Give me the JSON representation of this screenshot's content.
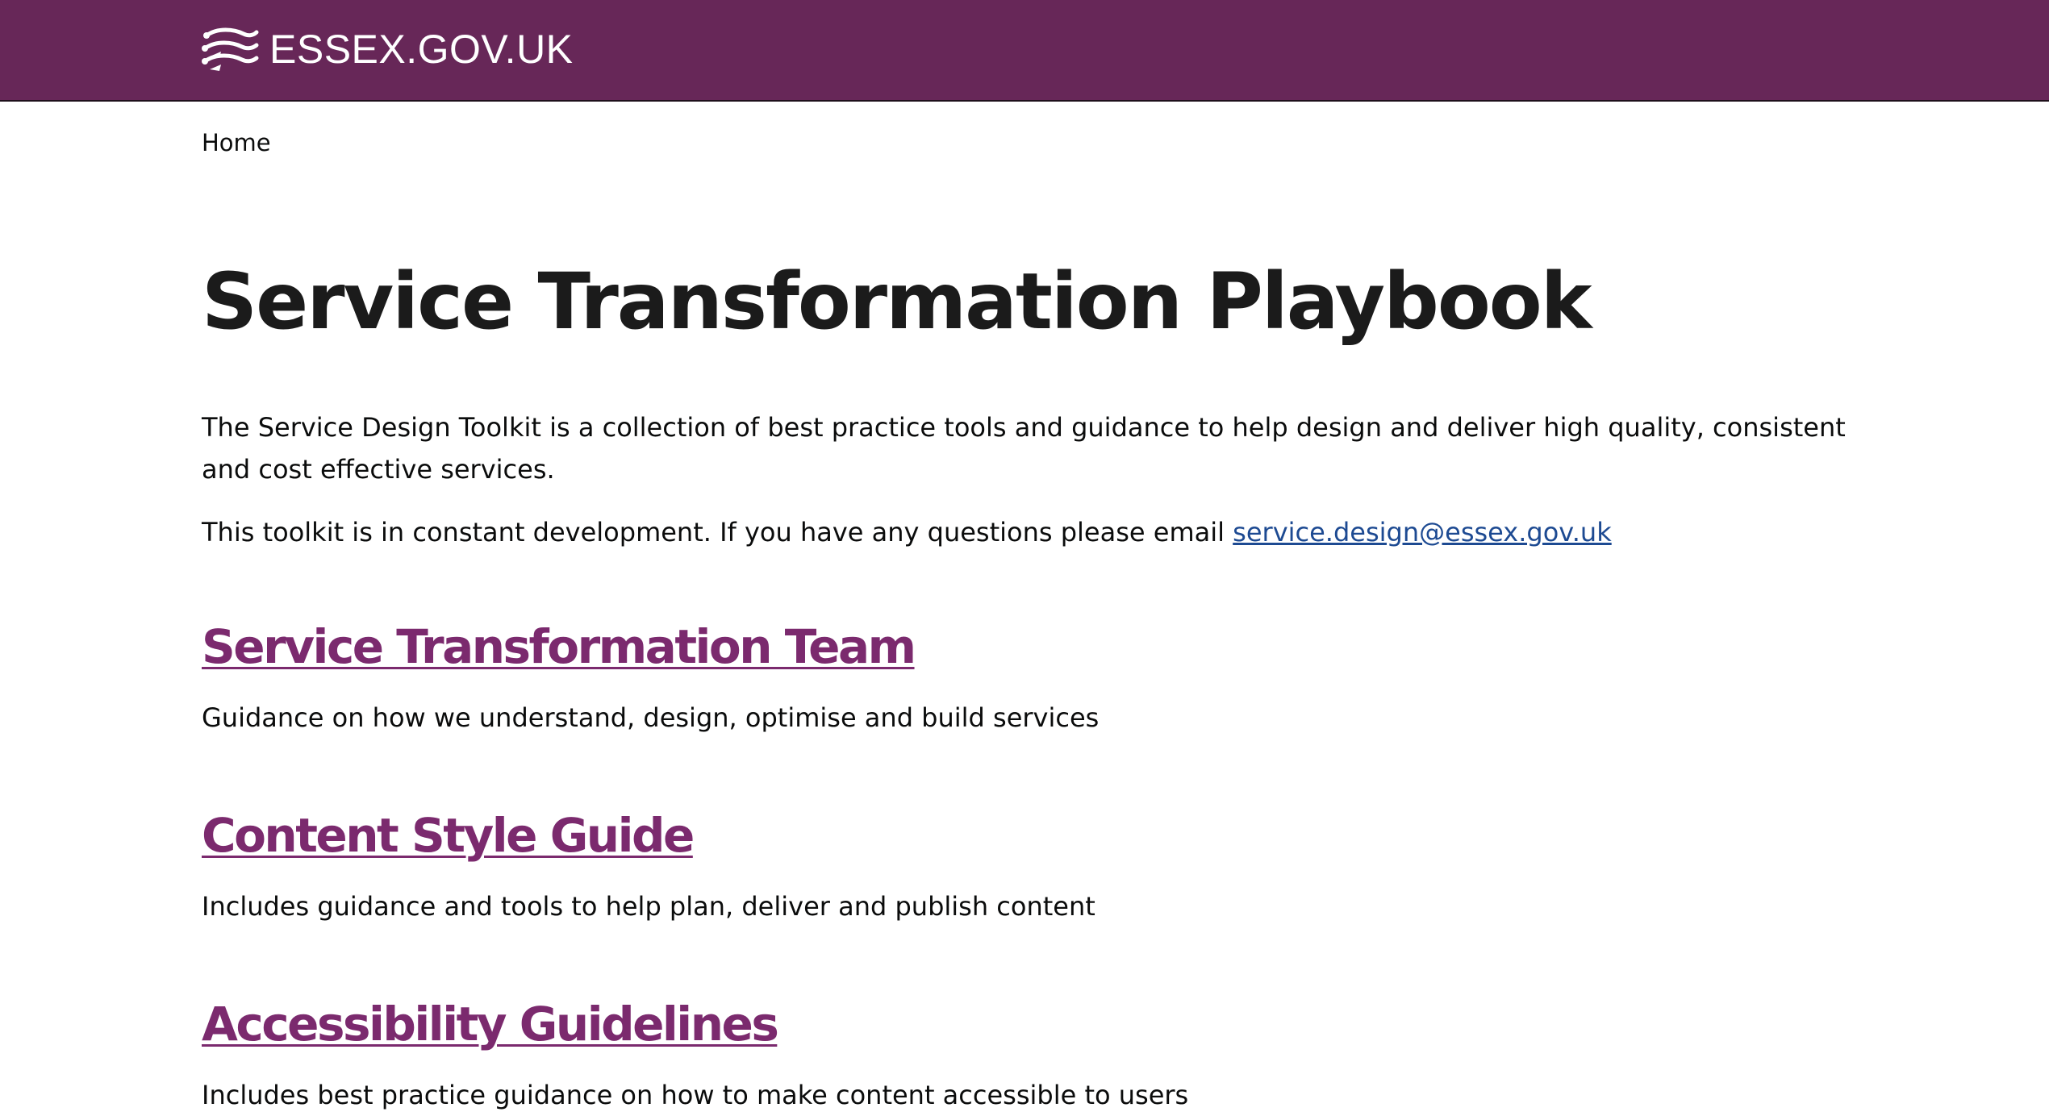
{
  "header": {
    "logo_text": "ESSEX.GOV.UK",
    "background_color": "#672758",
    "logo_icon": "essex-seaxes-icon"
  },
  "breadcrumb": {
    "home": "Home"
  },
  "page": {
    "title": "Service Transformation Playbook",
    "intro": "The Service Design Toolkit is a collection of best practice tools and guidance to help design and deliver high quality, consistent and cost effective services.",
    "note_prefix": "This toolkit is in constant development. If you have any questions please email ",
    "email": "service.design@essex.gov.uk",
    "link_color": "#1d4a92",
    "heading_link_color": "#7b2a6e"
  },
  "sections": [
    {
      "title": "Service Transformation Team",
      "description": "Guidance on how we understand, design, optimise and build services"
    },
    {
      "title": "Content Style Guide",
      "description": "Includes guidance and tools to help plan, deliver and publish content"
    },
    {
      "title": "Accessibility Guidelines",
      "description": "Includes best practice guidance on how to make content accessible to users"
    }
  ]
}
